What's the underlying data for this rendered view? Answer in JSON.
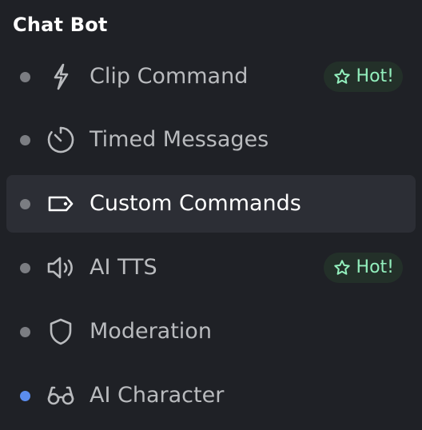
{
  "section": {
    "title": "Chat Bot"
  },
  "colors": {
    "background": "#1f2126",
    "active_item_bg": "#2c2e35",
    "text_muted": "#b9bbbe",
    "text_active": "#ffffff",
    "dot_gray": "#7b7d82",
    "dot_blue": "#5b8def",
    "badge_bg": "#233029",
    "badge_text": "#93efbd"
  },
  "nav": {
    "items": [
      {
        "label": "Clip Command",
        "icon": "lightning-icon",
        "status": "gray",
        "badge": "Hot!",
        "badge_icon": "star-icon",
        "active": false
      },
      {
        "label": "Timed Messages",
        "icon": "timer-icon",
        "status": "gray",
        "active": false
      },
      {
        "label": "Custom Commands",
        "icon": "tag-icon",
        "status": "gray",
        "active": true
      },
      {
        "label": "AI TTS",
        "icon": "speaker-icon",
        "status": "gray",
        "badge": "Hot!",
        "badge_icon": "star-icon",
        "active": false
      },
      {
        "label": "Moderation",
        "icon": "shield-icon",
        "status": "gray",
        "active": false
      },
      {
        "label": "AI Character",
        "icon": "glasses-icon",
        "status": "blue",
        "active": false
      }
    ]
  }
}
